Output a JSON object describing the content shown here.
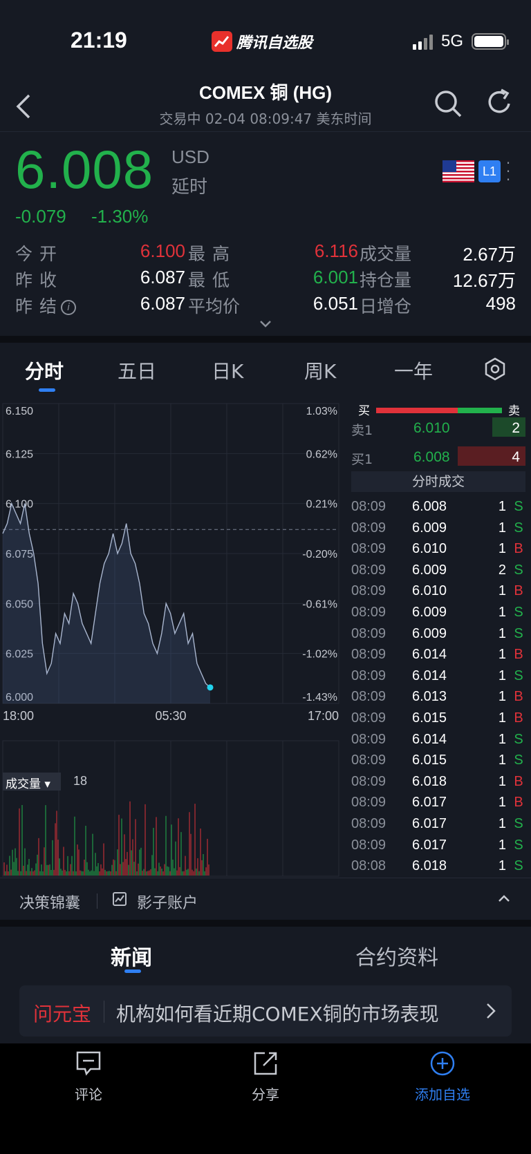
{
  "status_bar": {
    "time": "21:19",
    "app_name": "腾讯自选股",
    "network": "5G"
  },
  "header": {
    "title": "COMEX 铜 (HG)",
    "subtitle": "交易中  02-04 08:09:47 美东时间"
  },
  "quote": {
    "price": "6.008",
    "currency": "USD",
    "delay": "延时",
    "change": "-0.079",
    "change_pct": "-1.30%",
    "level_badge": "L1"
  },
  "stats": {
    "open_label": "今开",
    "open": "6.100",
    "high_label": "最高",
    "high": "6.116",
    "volume_label": "成交量",
    "volume": "2.67万",
    "prev_close_label": "昨收",
    "prev_close": "6.087",
    "low_label": "最低",
    "low": "6.001",
    "open_interest_label": "持仓量",
    "open_interest": "12.67万",
    "prev_settle_label": "昨结",
    "prev_settle": "6.087",
    "avg_label": "平均价",
    "avg": "6.051",
    "oi_change_label": "日增仓",
    "oi_change": "498"
  },
  "tabs": [
    "分时",
    "五日",
    "日K",
    "周K",
    "一年"
  ],
  "chart_data": {
    "type": "line",
    "y_ticks": [
      "6.150",
      "6.125",
      "6.100",
      "6.075",
      "6.050",
      "6.025",
      "6.000"
    ],
    "y_range": [
      6.0,
      6.15
    ],
    "pct_ticks": [
      "1.03%",
      "0.62%",
      "0.21%",
      "-0.20%",
      "-0.61%",
      "-1.02%",
      "-1.43%"
    ],
    "x_ticks": [
      "18:00",
      "05:30",
      "17:00"
    ],
    "reference_price": 6.087,
    "last_price": 6.008,
    "values": [
      6.085,
      6.09,
      6.1,
      6.095,
      6.09,
      6.1,
      6.085,
      6.075,
      6.06,
      6.03,
      6.015,
      6.02,
      6.035,
      6.03,
      6.045,
      6.04,
      6.055,
      6.05,
      6.04,
      6.035,
      6.03,
      6.045,
      6.06,
      6.07,
      6.075,
      6.085,
      6.075,
      6.08,
      6.09,
      6.075,
      6.07,
      6.06,
      6.045,
      6.04,
      6.03,
      6.025,
      6.035,
      6.05,
      6.045,
      6.035,
      6.04,
      6.045,
      6.03,
      6.035,
      6.02,
      6.015,
      6.01,
      6.008
    ],
    "volume_label": "成交量",
    "volume_value": "18"
  },
  "order_book": {
    "buy_label": "买",
    "sell_label": "卖",
    "ask": {
      "label": "卖1",
      "price": "6.010",
      "qty": "2"
    },
    "bid": {
      "label": "买1",
      "price": "6.008",
      "qty": "4"
    },
    "trades_title": "分时成交",
    "trades": [
      {
        "time": "08:09",
        "price": "6.008",
        "qty": "1",
        "side": "S"
      },
      {
        "time": "08:09",
        "price": "6.009",
        "qty": "1",
        "side": "S"
      },
      {
        "time": "08:09",
        "price": "6.010",
        "qty": "1",
        "side": "B"
      },
      {
        "time": "08:09",
        "price": "6.009",
        "qty": "2",
        "side": "S"
      },
      {
        "time": "08:09",
        "price": "6.010",
        "qty": "1",
        "side": "B"
      },
      {
        "time": "08:09",
        "price": "6.009",
        "qty": "1",
        "side": "S"
      },
      {
        "time": "08:09",
        "price": "6.009",
        "qty": "1",
        "side": "S"
      },
      {
        "time": "08:09",
        "price": "6.014",
        "qty": "1",
        "side": "B"
      },
      {
        "time": "08:09",
        "price": "6.014",
        "qty": "1",
        "side": "S"
      },
      {
        "time": "08:09",
        "price": "6.013",
        "qty": "1",
        "side": "B"
      },
      {
        "time": "08:09",
        "price": "6.015",
        "qty": "1",
        "side": "B"
      },
      {
        "time": "08:09",
        "price": "6.014",
        "qty": "1",
        "side": "S"
      },
      {
        "time": "08:09",
        "price": "6.015",
        "qty": "1",
        "side": "S"
      },
      {
        "time": "08:09",
        "price": "6.018",
        "qty": "1",
        "side": "B"
      },
      {
        "time": "08:09",
        "price": "6.017",
        "qty": "1",
        "side": "B"
      },
      {
        "time": "08:09",
        "price": "6.017",
        "qty": "1",
        "side": "S"
      },
      {
        "time": "08:09",
        "price": "6.017",
        "qty": "1",
        "side": "S"
      },
      {
        "time": "08:08",
        "price": "6.018",
        "qty": "1",
        "side": "S"
      }
    ]
  },
  "tools": {
    "decision": "决策锦囊",
    "shadow": "影子账户"
  },
  "news_tabs": {
    "news": "新闻",
    "contract": "合约资料"
  },
  "ai_card": {
    "brand": "问元宝",
    "text": "机构如何看近期COMEX铜的市场表现"
  },
  "bottom_bar": {
    "comment": "评论",
    "share": "分享",
    "add": "添加自选"
  },
  "colors": {
    "up": "#e0323a",
    "down": "#22b14c",
    "accent": "#2f7ff2",
    "background": "#161a23"
  }
}
